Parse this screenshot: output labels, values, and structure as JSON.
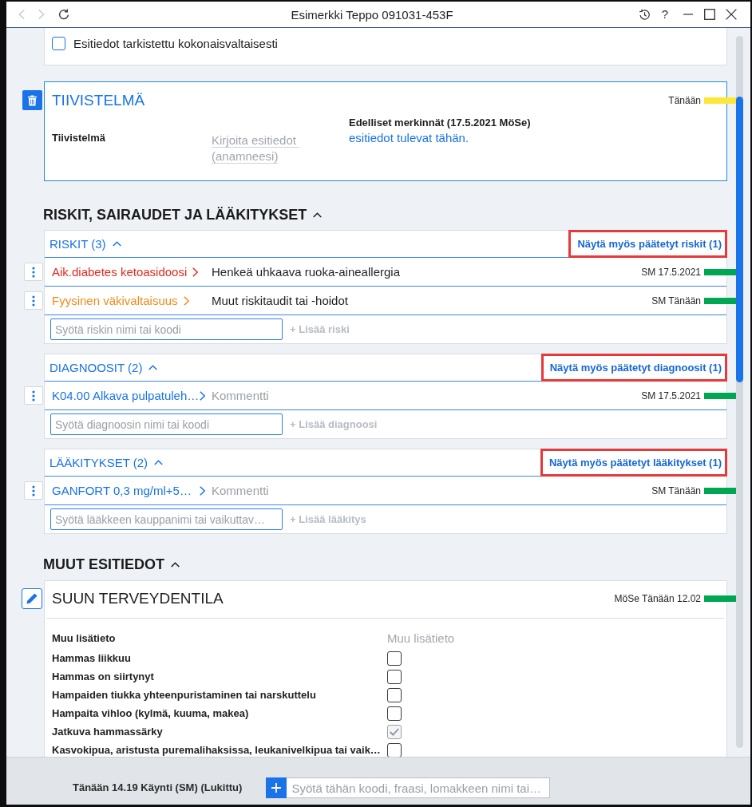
{
  "window": {
    "title": "Esimerkki Teppo 091031-453F",
    "nav_buttons": [
      {
        "kind": "back",
        "disabled": true
      },
      {
        "kind": "forward",
        "disabled": true
      },
      {
        "kind": "reload",
        "disabled": false
      }
    ],
    "controls": [
      {
        "kind": "history"
      },
      {
        "kind": "help",
        "label": "?"
      },
      {
        "kind": "minimize"
      },
      {
        "kind": "maximize"
      },
      {
        "kind": "close"
      }
    ]
  },
  "review": {
    "label": "Esitiedot tarkistettu kokonaisvaltaisesti",
    "checked": false
  },
  "summary": {
    "title": "TIIVISTELMÄ",
    "stamp": {
      "text": "Tänään",
      "color": "#fde83a"
    },
    "field_label": "Tiivistelmä",
    "placeholder": "Kirjoita esitiedot (anamneesi)",
    "previous": {
      "heading": "Edelliset merkinnät (17.5.2021 MöSe)",
      "text": "esitiedot tulevat tähän."
    }
  },
  "conditions": {
    "heading": "RISKIT, SAIRAUDET JA LÄÄKITYKSET",
    "expanded": true,
    "groups": [
      {
        "title": "RISKIT (3)",
        "expanded": true,
        "show_ended": {
          "label": "Näytä myös päätetyt riskit (1)",
          "highlighted": true
        },
        "rows": [
          {
            "kind": "risk",
            "name": "Aik.diabetes ketoasidoosi",
            "color": "#e0291f",
            "detail": "Henkeä uhkaava ruoka-aineallergia",
            "stamp": {
              "text": "SM 17.5.2021",
              "color": "#00a651"
            }
          },
          {
            "kind": "risk",
            "name": "Fyysinen väkivaltaisuus",
            "color": "#f28a1c",
            "detail": "Muut riskitaudit tai -hoidot",
            "stamp": {
              "text": "SM Tänään",
              "color": "#00a651"
            }
          }
        ],
        "input": {
          "placeholder": "Syötä riskin nimi tai koodi"
        },
        "add_button": {
          "label": "+ Lisää riski",
          "disabled": true
        }
      },
      {
        "title": "DIAGNOOSIT (2)",
        "expanded": true,
        "show_ended": {
          "label": "Näytä myös päätetyt diagnoosit (1)",
          "highlighted": true
        },
        "rows": [
          {
            "kind": "entry",
            "name": "K04.00 Alkava pulpatuleh…",
            "color": "#1a73e8",
            "detail": "Kommentti",
            "stamp": {
              "text": "SM 17.5.2021",
              "color": "#00a651"
            }
          }
        ],
        "input": {
          "placeholder": "Syötä diagnoosin nimi tai koodi"
        },
        "add_button": {
          "label": "+ Lisää diagnoosi",
          "disabled": true
        }
      },
      {
        "title": "LÄÄKITYKSET (2)",
        "expanded": true,
        "show_ended": {
          "label": "Näytä myös päätetyt lääkitykset (1)",
          "highlighted": true
        },
        "rows": [
          {
            "kind": "entry",
            "name": "GANFORT 0,3 mg/ml+5…",
            "color": "#1a73e8",
            "detail": "Kommentti",
            "stamp": {
              "text": "SM Tänään",
              "color": "#00a651"
            }
          }
        ],
        "input": {
          "placeholder": "Syötä lääkkeen kauppanimi tai vaikuttav…"
        },
        "add_button": {
          "label": "+ Lisää lääkitys",
          "disabled": true
        }
      }
    ]
  },
  "other": {
    "heading": "MUUT ESITIEDOT",
    "expanded": true,
    "forms": [
      {
        "title": "SUUN TERVEYDENTILA",
        "stamp": {
          "text": "MöSe Tänään 12.02",
          "color": "#00a651"
        },
        "fields": [
          {
            "kind": "text",
            "label": "Muu lisätieto",
            "placeholder": "Muu lisätieto"
          },
          {
            "kind": "checkbox",
            "label": "Hammas liikkuu",
            "checked": false
          },
          {
            "kind": "checkbox",
            "label": "Hammas on siirtynyt",
            "checked": false
          },
          {
            "kind": "checkbox",
            "label": "Hampaiden tiukka yhteenpuristaminen tai narskuttelu",
            "checked": false
          },
          {
            "kind": "checkbox",
            "label": "Hampaita vihloo (kylmä, kuuma, makea)",
            "checked": false
          },
          {
            "kind": "checkbox",
            "label": "Jatkuva hammassärky",
            "checked": true
          },
          {
            "kind": "checkbox",
            "label": "Kasvokipua, aristusta puremalihaksissa, leukanivelkipua tai vaik…",
            "checked": false
          }
        ]
      }
    ]
  },
  "footer": {
    "visit": "Tänään 14.19 Käynti (SM) (Lukittu)",
    "input": {
      "placeholder": "Syötä tähän koodi, fraasi, lomakkeen nimi tai…"
    }
  }
}
